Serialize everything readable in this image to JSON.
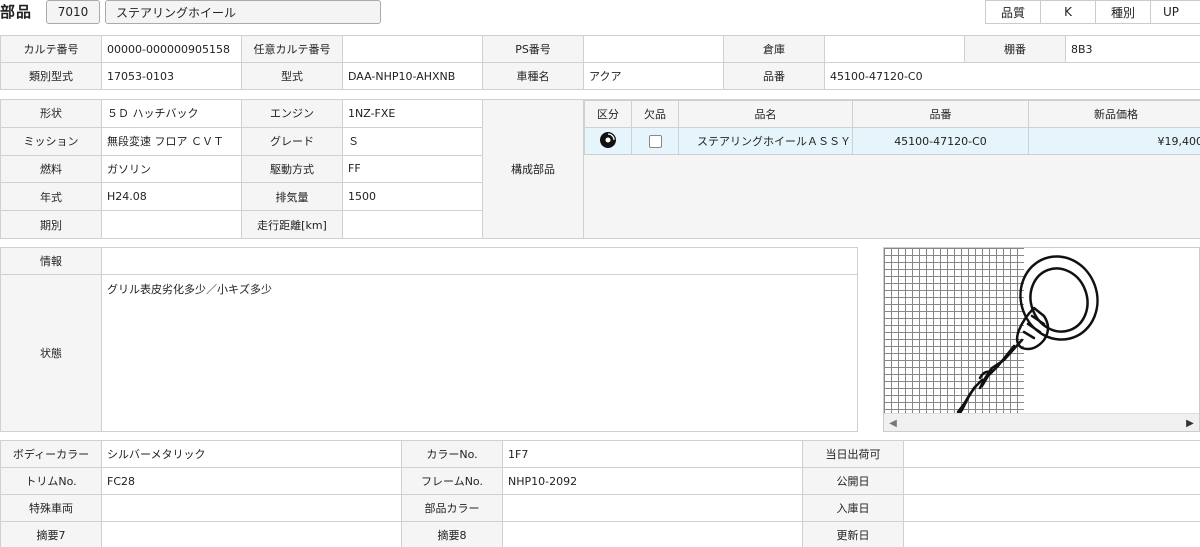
{
  "header": {
    "title": "部品",
    "code": "7010",
    "name": "ステアリングホイール",
    "quality_label": "品質",
    "quality_value": "K",
    "kind_label": "種別",
    "kind_value": "UP"
  },
  "row1": {
    "karte_label": "カルテ番号",
    "karte_value": "00000-000000905158",
    "nkarte_label": "任意カルテ番号",
    "nkarte_value": "",
    "ps_label": "PS番号",
    "ps_value": "",
    "warehouse_label": "倉庫",
    "warehouse_value": "",
    "shelf_label": "棚番",
    "shelf_value": "8B3"
  },
  "row2": {
    "class_label": "類別型式",
    "class_value": "17053-0103",
    "model_label": "型式",
    "model_value": "DAA-NHP10-AHXNB",
    "car_label": "車種名",
    "car_value": "アクア",
    "part_no_label": "品番",
    "part_no_value": "45100-47120-C0"
  },
  "specs": [
    {
      "l1": "形状",
      "v1": "５Ｄ ハッチバック",
      "l2": "エンジン",
      "v2": "1NZ-FXE"
    },
    {
      "l1": "ミッション",
      "v1": "無段変速 フロア ＣＶＴ",
      "l2": "グレード",
      "v2": "Ｓ"
    },
    {
      "l1": "燃料",
      "v1": "ガソリン",
      "l2": "駆動方式",
      "v2": "FF"
    },
    {
      "l1": "年式",
      "v1": "H24.08",
      "l2": "排気量",
      "v2": "1500"
    },
    {
      "l1": "期別",
      "v1": "",
      "l2": "走行距離[km]",
      "v2": ""
    }
  ],
  "components_label": "構成部品",
  "parts_table": {
    "headers": [
      "区分",
      "欠品",
      "品名",
      "品番",
      "新品価格"
    ],
    "row": {
      "kind_icon": "disc-icon",
      "name": "ステアリングホイールＡＳＳＹ",
      "number": "45100-47120-C0",
      "price": "¥19,400"
    }
  },
  "info": {
    "info_label": "情報",
    "info_value": "",
    "status_label": "状態",
    "status_value": "グリル表皮劣化多少／小キズ多少"
  },
  "bottom": [
    {
      "l1": "ボディーカラー",
      "v1": "シルバーメタリック",
      "l2": "カラーNo.",
      "v2": "1F7",
      "l3": "当日出荷可",
      "v3": ""
    },
    {
      "l1": "トリムNo.",
      "v1": "FC28",
      "l2": "フレームNo.",
      "v2": "NHP10-2092",
      "l3": "公開日",
      "v3": ""
    },
    {
      "l1": "特殊車両",
      "v1": "",
      "l2": "部品カラー",
      "v2": "",
      "l3": "入庫日",
      "v3": ""
    },
    {
      "l1": "摘要7",
      "v1": "",
      "l2": "摘要8",
      "v2": "",
      "l3": "更新日",
      "v3": ""
    }
  ],
  "image": {
    "icon": "steering-wheel-diagram-icon"
  }
}
